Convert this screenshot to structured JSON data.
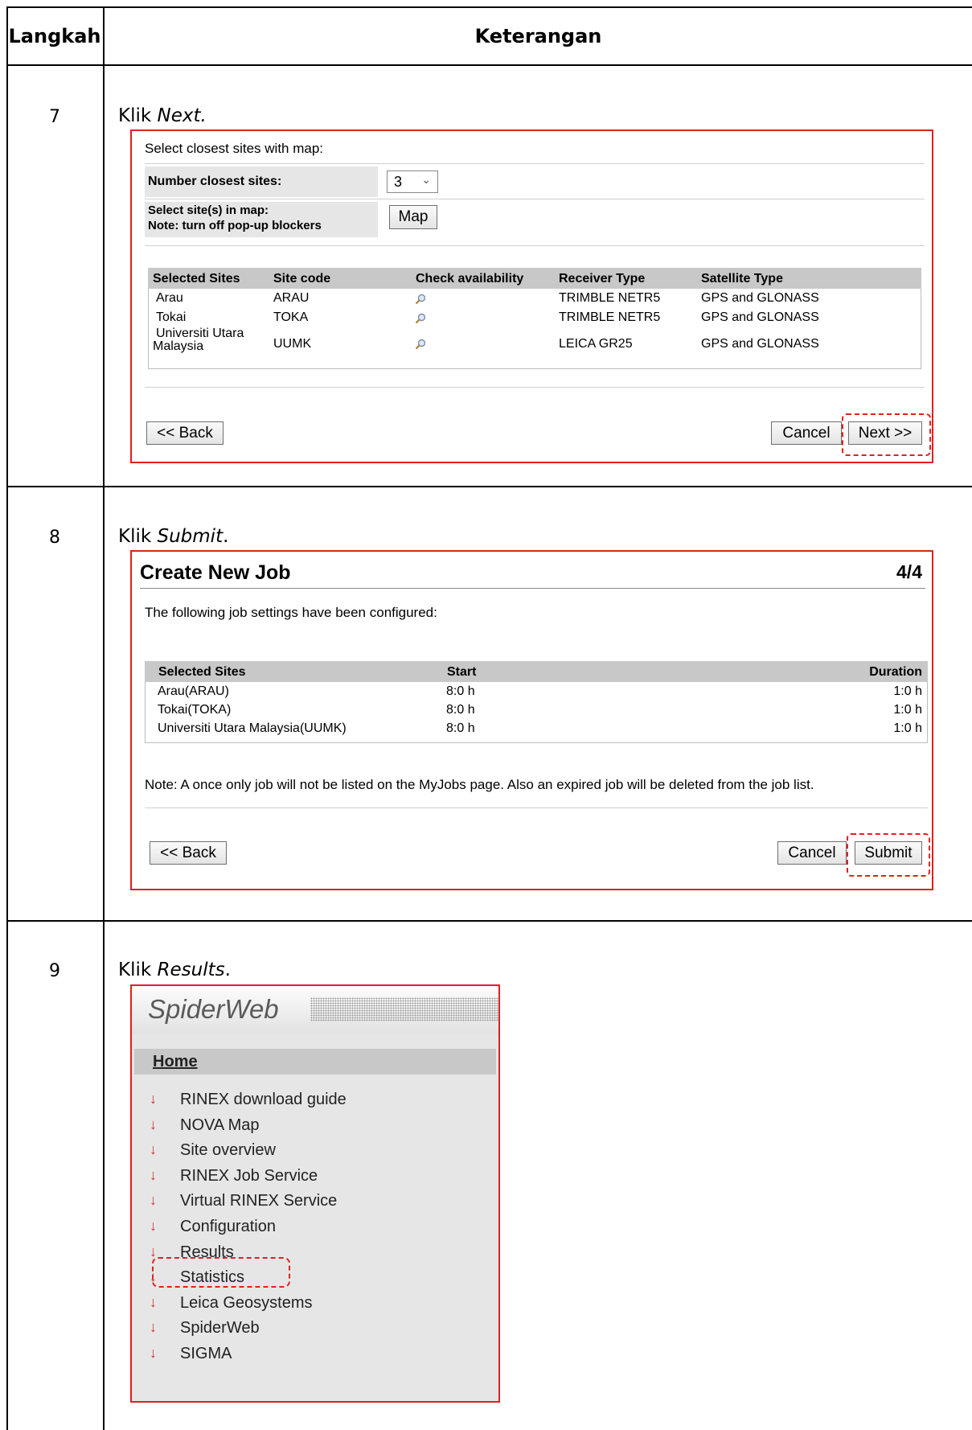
{
  "table": {
    "col_step": "Langkah",
    "col_desc": "Keterangan"
  },
  "steps": [
    {
      "num": "7",
      "prefix": "Klik ",
      "action": "Next.",
      "suffix": ""
    },
    {
      "num": "8",
      "prefix": "Klik ",
      "action": "Submit",
      "suffix": "."
    },
    {
      "num": "9",
      "prefix": "Klik ",
      "action": "Results",
      "suffix": "."
    }
  ],
  "shot1": {
    "heading": "Select closest sites with map:",
    "number_label": "Number closest sites:",
    "number_value": "3",
    "select_label_1": "Select site(s) in map:",
    "select_label_2": "Note: turn off pop-up blockers",
    "map_button": "Map",
    "columns": [
      "Selected Sites",
      "Site code",
      "Check availability",
      "Receiver Type",
      "Satellite Type"
    ],
    "rows": [
      {
        "site": "Arau",
        "code": "ARAU",
        "receiver": "TRIMBLE NETR5",
        "satellite": "GPS and GLONASS"
      },
      {
        "site": "Tokai",
        "code": "TOKA",
        "receiver": "TRIMBLE NETR5",
        "satellite": "GPS and GLONASS"
      },
      {
        "site_line1": "Universiti Utara",
        "site_line2": "Malaysia",
        "code": "UUMK",
        "receiver": "LEICA GR25",
        "satellite": "GPS and GLONASS"
      }
    ],
    "back_button": "<< Back",
    "cancel_button": "Cancel",
    "next_button": "Next >>"
  },
  "shot2": {
    "title": "Create New Job",
    "page": "4/4",
    "intro": "The following job settings have been configured:",
    "columns": [
      "Selected Sites",
      "Start",
      "Duration"
    ],
    "rows": [
      {
        "site": "Arau(ARAU)",
        "start": "8:0 h",
        "duration": "1:0 h"
      },
      {
        "site": "Tokai(TOKA)",
        "start": "8:0 h",
        "duration": "1:0 h"
      },
      {
        "site": "Universiti Utara Malaysia(UUMK)",
        "start": "8:0 h",
        "duration": "1:0 h"
      }
    ],
    "note": "Note: A once only job will not be listed on the MyJobs page. Also an expired job will be deleted from the job list.",
    "back_button": "<< Back",
    "cancel_button": "Cancel",
    "submit_button": "Submit"
  },
  "shot3": {
    "logo": "SpiderWeb",
    "home": "Home",
    "menu": [
      "RINEX download guide",
      "NOVA Map",
      "Site overview",
      "RINEX Job Service",
      "Virtual RINEX Service",
      "Configuration",
      "Results",
      "Statistics",
      "Leica Geosystems",
      "SpiderWeb",
      "SIGMA"
    ],
    "arrow_icon": "↓",
    "accent": "#e02020"
  }
}
